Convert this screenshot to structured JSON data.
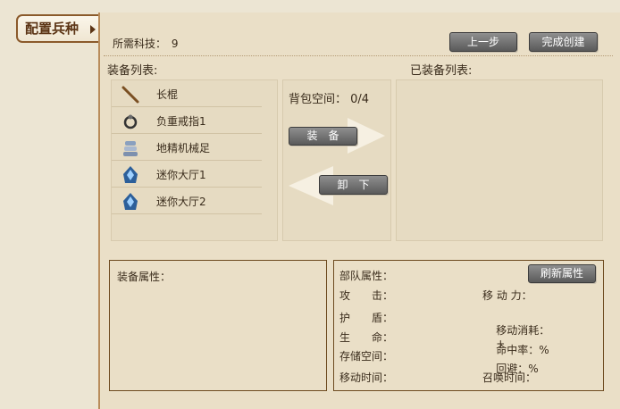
{
  "tab": {
    "label": "配置兵种"
  },
  "header": {
    "tech_label": "所需科技：",
    "tech_value": "9",
    "prev_button": "上一步",
    "finish_button": "完成创建"
  },
  "equipment_list": {
    "title": "装备列表:",
    "items": [
      {
        "icon": "staff-icon",
        "name": "长棍"
      },
      {
        "icon": "ring-icon",
        "name": "负重戒指1"
      },
      {
        "icon": "mech-feet-icon",
        "name": "地精机械足"
      },
      {
        "icon": "hall-icon",
        "name": "迷你大厅1"
      },
      {
        "icon": "hall-icon",
        "name": "迷你大厅2"
      }
    ]
  },
  "backpack": {
    "label": "背包空间：",
    "value": "0/4",
    "equip_button": "装　备",
    "unequip_button": "卸　下"
  },
  "equipped_list": {
    "title": "已装备列表:"
  },
  "equip_attributes": {
    "title": "装备属性："
  },
  "unit_attributes": {
    "title": "部队属性：",
    "refresh_button": "刷新属性",
    "attack": "攻　　击：",
    "move_power": "移 动 力：",
    "shield": "护　　盾：",
    "move_cost": "移动消耗：",
    "move_cost_value": "+",
    "life": "生　　命：",
    "hit_rate": "命中率：",
    "hit_rate_value": "%",
    "storage": "存储空间：",
    "evade": "回避：",
    "evade_value": "%",
    "move_time": "移动时间：",
    "summon_time": "召唤时间："
  }
}
